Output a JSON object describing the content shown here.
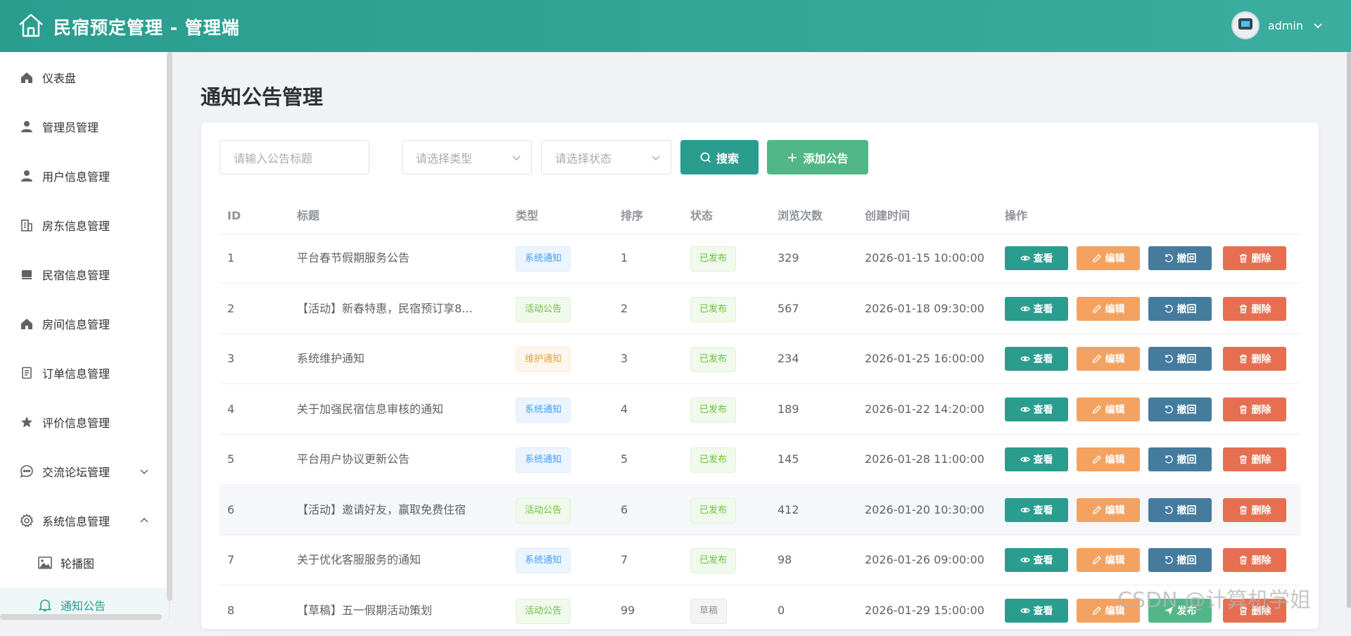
{
  "header": {
    "app_title": "民宿预定管理 - 管理端",
    "username": "admin"
  },
  "colors": {
    "primary": "#2a9d8f",
    "add": "#52b788",
    "edit": "#f4a261",
    "revoke": "#457b9d",
    "delete": "#e76f51"
  },
  "sidebar": {
    "items": [
      {
        "label": "仪表盘",
        "icon": "home-icon"
      },
      {
        "label": "管理员管理",
        "icon": "user-icon"
      },
      {
        "label": "用户信息管理",
        "icon": "user-icon"
      },
      {
        "label": "房东信息管理",
        "icon": "building-icon"
      },
      {
        "label": "民宿信息管理",
        "icon": "bed-icon"
      },
      {
        "label": "房间信息管理",
        "icon": "home-icon"
      },
      {
        "label": "订单信息管理",
        "icon": "document-icon"
      },
      {
        "label": "评价信息管理",
        "icon": "star-icon"
      },
      {
        "label": "交流论坛管理",
        "icon": "chat-icon",
        "expanded": false
      },
      {
        "label": "系统信息管理",
        "icon": "gear-icon",
        "expanded": true
      }
    ],
    "subitems": [
      {
        "label": "轮播图",
        "icon": "image-icon"
      },
      {
        "label": "通知公告",
        "icon": "bell-icon",
        "active": true
      }
    ]
  },
  "page": {
    "title": "通知公告管理"
  },
  "filters": {
    "title_placeholder": "请输入公告标题",
    "type_placeholder": "请选择类型",
    "status_placeholder": "请选择状态",
    "search_label": "搜索",
    "add_label": "添加公告"
  },
  "table": {
    "columns": [
      "ID",
      "标题",
      "类型",
      "排序",
      "状态",
      "浏览次数",
      "创建时间",
      "操作"
    ],
    "rows": [
      {
        "id": "1",
        "title": "平台春节假期服务公告",
        "type": "系统通知",
        "sort": "1",
        "status": "已发布",
        "views": "329",
        "created": "2026-01-15 10:00:00"
      },
      {
        "id": "2",
        "title": "【活动】新春特惠，民宿预订享8...",
        "type": "活动公告",
        "sort": "2",
        "status": "已发布",
        "views": "567",
        "created": "2026-01-18 09:30:00"
      },
      {
        "id": "3",
        "title": "系统维护通知",
        "type": "维护通知",
        "sort": "3",
        "status": "已发布",
        "views": "234",
        "created": "2026-01-25 16:00:00"
      },
      {
        "id": "4",
        "title": "关于加强民宿信息审核的通知",
        "type": "系统通知",
        "sort": "4",
        "status": "已发布",
        "views": "189",
        "created": "2026-01-22 14:20:00"
      },
      {
        "id": "5",
        "title": "平台用户协议更新公告",
        "type": "系统通知",
        "sort": "5",
        "status": "已发布",
        "views": "145",
        "created": "2026-01-28 11:00:00"
      },
      {
        "id": "6",
        "title": "【活动】邀请好友，赢取免费住宿",
        "type": "活动公告",
        "sort": "6",
        "status": "已发布",
        "views": "412",
        "created": "2026-01-20 10:30:00"
      },
      {
        "id": "7",
        "title": "关于优化客服服务的通知",
        "type": "系统通知",
        "sort": "7",
        "status": "已发布",
        "views": "98",
        "created": "2026-01-26 09:00:00"
      },
      {
        "id": "8",
        "title": "【草稿】五一假期活动策划",
        "type": "活动公告",
        "sort": "99",
        "status": "草稿",
        "views": "0",
        "created": "2026-01-29 15:00:00"
      }
    ],
    "actions": {
      "view": "查看",
      "edit": "编辑",
      "revoke": "撤回",
      "publish": "发布",
      "delete": "删除"
    }
  },
  "watermark": "CSDN @计算机学姐"
}
